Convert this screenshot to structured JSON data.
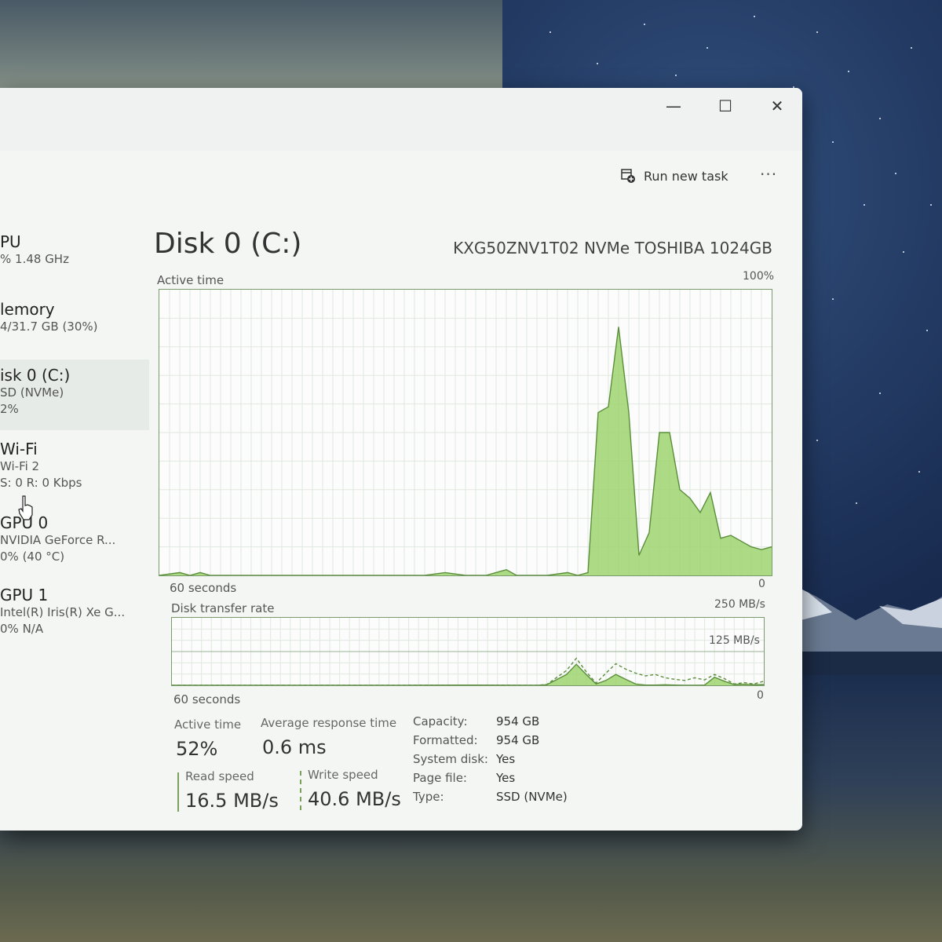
{
  "window": {
    "controls": {
      "minimize": "—",
      "maximize": "☐",
      "close": "✕"
    }
  },
  "toolbar": {
    "run_new_task": "Run new task",
    "more": "···"
  },
  "sidebar": {
    "items": [
      {
        "title": "PU",
        "subtitle1": "% 1.48 GHz",
        "subtitle2": ""
      },
      {
        "title": "lemory",
        "subtitle1": "4/31.7 GB (30%)",
        "subtitle2": ""
      },
      {
        "title": "isk 0 (C:)",
        "subtitle1": "SD (NVMe)",
        "subtitle2": "2%"
      },
      {
        "title": "Wi-Fi",
        "subtitle1": "Wi-Fi 2",
        "subtitle2": "S: 0 R: 0 Kbps"
      },
      {
        "title": "GPU 0",
        "subtitle1": "NVIDIA GeForce R...",
        "subtitle2": "0% (40 °C)"
      },
      {
        "title": "GPU 1",
        "subtitle1": "Intel(R) Iris(R) Xe G...",
        "subtitle2": "0% N/A"
      }
    ]
  },
  "header": {
    "title": "Disk 0 (C:)",
    "model": "KXG50ZNV1T02 NVMe TOSHIBA 1024GB"
  },
  "active_graph": {
    "label": "Active time",
    "max_label": "100%",
    "left_label": "60 seconds",
    "right_label": "0"
  },
  "transfer_graph": {
    "label": "Disk transfer rate",
    "max_label": "250 MB/s",
    "mid_label": "125 MB/s",
    "left_label": "60 seconds",
    "right_label": "0"
  },
  "stats": {
    "active_time_label": "Active time",
    "active_time_value": "52%",
    "avg_response_label": "Average response time",
    "avg_response_value": "0.6 ms",
    "read_speed_label": "Read speed",
    "read_speed_value": "16.5 MB/s",
    "write_speed_label": "Write speed",
    "write_speed_value": "40.6 MB/s"
  },
  "properties": [
    {
      "key": "Capacity:",
      "value": "954 GB"
    },
    {
      "key": "Formatted:",
      "value": "954 GB"
    },
    {
      "key": "System disk:",
      "value": "Yes"
    },
    {
      "key": "Page file:",
      "value": "Yes"
    },
    {
      "key": "Type:",
      "value": "SSD (NVMe)"
    }
  ],
  "chart_data": [
    {
      "type": "area",
      "title": "Active time",
      "ylim": [
        0,
        100
      ],
      "x": [
        0,
        2,
        3,
        4,
        5,
        6,
        8,
        10,
        12,
        14,
        16,
        18,
        20,
        22,
        24,
        26,
        28,
        30,
        32,
        34,
        35,
        36,
        37,
        38,
        40,
        41,
        42,
        43,
        44,
        45,
        46,
        47,
        48,
        49,
        50,
        51,
        52,
        53,
        54,
        55,
        56,
        57,
        58,
        59,
        60
      ],
      "series": [
        {
          "values": [
            0,
            1,
            0,
            1,
            0,
            0,
            0,
            0,
            0,
            0,
            0,
            0,
            0,
            0,
            0,
            0,
            1,
            0,
            0,
            2,
            0,
            0,
            0,
            0,
            1,
            0,
            1,
            57,
            59,
            87,
            57,
            7,
            15,
            50,
            50,
            30,
            27,
            22,
            29,
            13,
            14,
            12,
            10,
            9,
            10
          ]
        }
      ]
    },
    {
      "type": "area",
      "title": "Disk transfer rate",
      "ylim": [
        0,
        250
      ],
      "x": [
        0,
        5,
        10,
        20,
        30,
        37,
        38,
        40,
        41,
        42,
        43,
        44,
        45,
        46,
        47,
        48,
        49,
        50,
        51,
        52,
        53,
        54,
        55,
        56,
        57,
        58,
        59,
        60
      ],
      "series": [
        {
          "values": [
            0,
            0,
            0,
            0,
            1,
            0,
            2,
            40,
            78,
            40,
            5,
            18,
            40,
            22,
            5,
            1,
            1,
            2,
            1,
            0,
            0,
            1,
            30,
            15,
            3,
            4,
            2,
            3
          ]
        },
        {
          "values": [
            0,
            0,
            0,
            0,
            1,
            0,
            3,
            55,
            100,
            50,
            8,
            45,
            80,
            60,
            45,
            35,
            40,
            28,
            22,
            18,
            28,
            20,
            40,
            25,
            5,
            10,
            5,
            15
          ]
        }
      ]
    }
  ]
}
